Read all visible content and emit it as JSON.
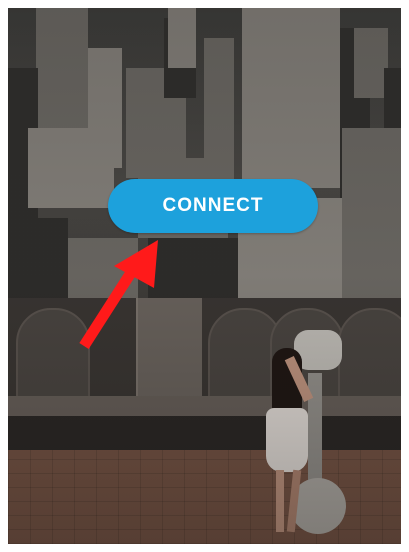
{
  "connect_button": {
    "label": "CONNECT",
    "color": "#1da1dc",
    "text_color": "#ffffff"
  },
  "annotation": {
    "icon": "arrow-up-right-icon",
    "color": "#ff1a1a"
  }
}
